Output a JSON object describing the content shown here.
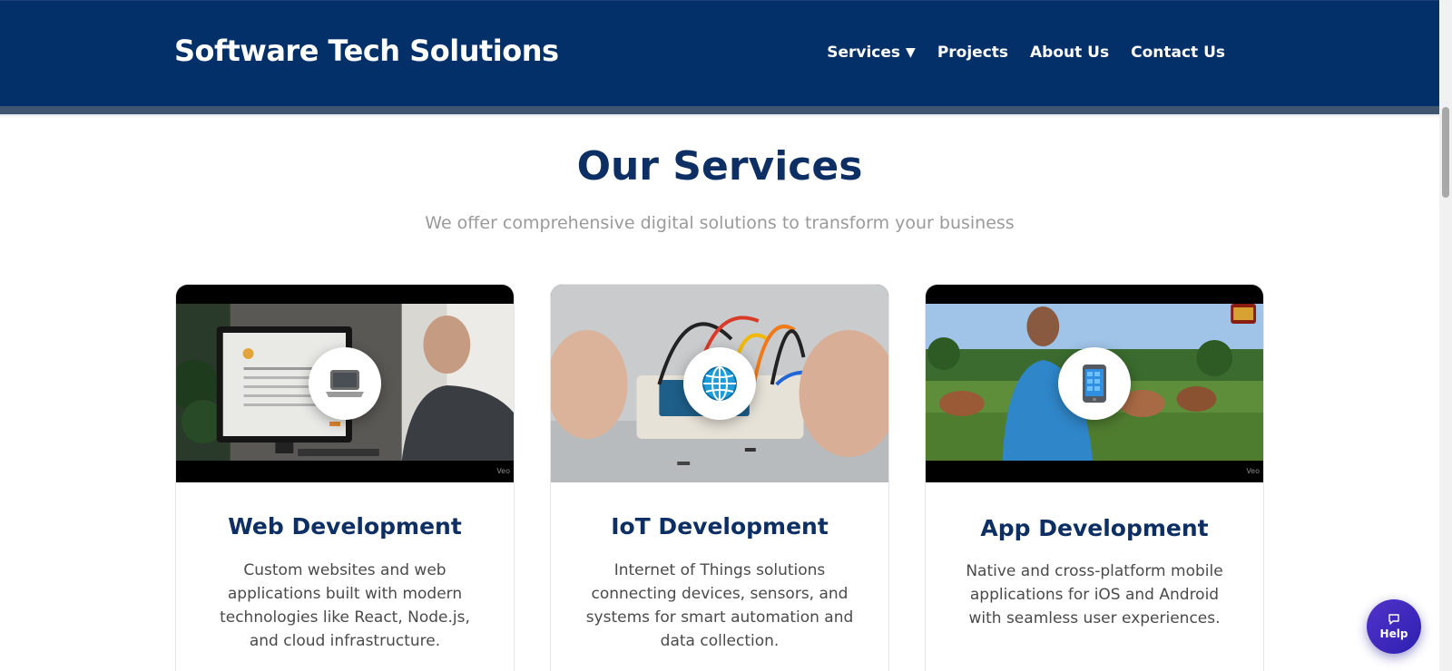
{
  "header": {
    "brand": "Software Tech Solutions",
    "nav": {
      "services": "Services",
      "projects": "Projects",
      "about": "About Us",
      "contact": "Contact Us"
    }
  },
  "services_section": {
    "title": "Our Services",
    "subtitle": "We offer comprehensive digital solutions to transform your business"
  },
  "cards": [
    {
      "title": "Web Development",
      "description": "Custom websites and web applications built with modern technologies like React, Node.js, and cloud infrastructure.",
      "icon": "laptop-icon",
      "media_label": "Veo"
    },
    {
      "title": "IoT Development",
      "description": "Internet of Things solutions connecting devices, sensors, and systems for smart automation and data collection.",
      "icon": "globe-icon"
    },
    {
      "title": "App Development",
      "description": "Native and cross-platform mobile applications for iOS and Android with seamless user experiences.",
      "icon": "mobile-phone-icon",
      "media_label": "Veo"
    }
  ],
  "help": {
    "label": "Help",
    "icon": "chat-icon"
  },
  "colors": {
    "header_bg": "#043069",
    "title_color": "#0d2f63",
    "help_bg": "#3f28be"
  }
}
